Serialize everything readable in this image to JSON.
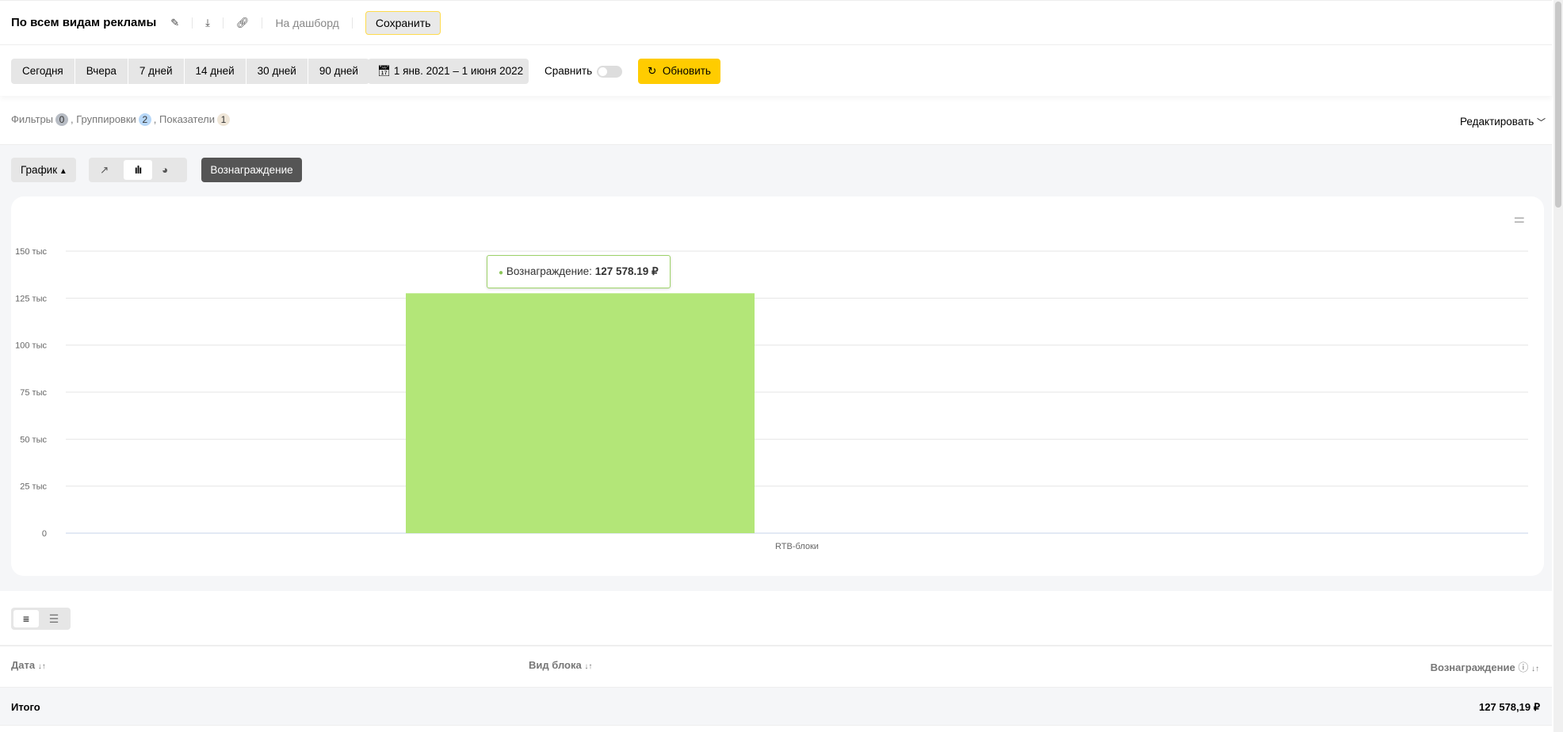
{
  "header": {
    "title": "По всем видам рекламы",
    "to_dashboard": "На дашборд",
    "save": "Сохранить"
  },
  "toolbar": {
    "presets": [
      "Сегодня",
      "Вчера",
      "7 дней",
      "14 дней",
      "30 дней",
      "90 дней"
    ],
    "date_range": "1 янв. 2021 – 1 июня 2022",
    "compare": "Сравнить",
    "compare_on": false,
    "refresh": "Обновить"
  },
  "filters": {
    "filters_label": "Фильтры",
    "filters_count": "0",
    "groupings_label": ", Группировки",
    "groupings_count": "2",
    "metrics_label": ", Показатели",
    "metrics_count": "1",
    "edit": "Редактировать"
  },
  "chart_controls": {
    "graph": "График",
    "metric": "Вознаграждение"
  },
  "chart_data": {
    "type": "bar",
    "categories": [
      "RTB-блоки"
    ],
    "series": [
      {
        "name": "Вознаграждение",
        "values": [
          127578.19
        ],
        "color": "#b3e678"
      }
    ],
    "ylim": [
      0,
      150000
    ],
    "yticks": [
      0,
      25000,
      50000,
      75000,
      100000,
      125000,
      150000
    ],
    "ytick_labels": [
      "0",
      "25 тыс",
      "50 тыс",
      "75 тыс",
      "100 тыс",
      "125 тыс",
      "150 тыс"
    ],
    "tooltip": {
      "label": "Вознаграждение:",
      "value": "127 578.19 ₽"
    }
  },
  "table": {
    "columns": [
      "Дата",
      "Вид блока",
      "Вознаграждение"
    ],
    "total_label": "Итого",
    "total_value": "127 578,19 ₽"
  }
}
